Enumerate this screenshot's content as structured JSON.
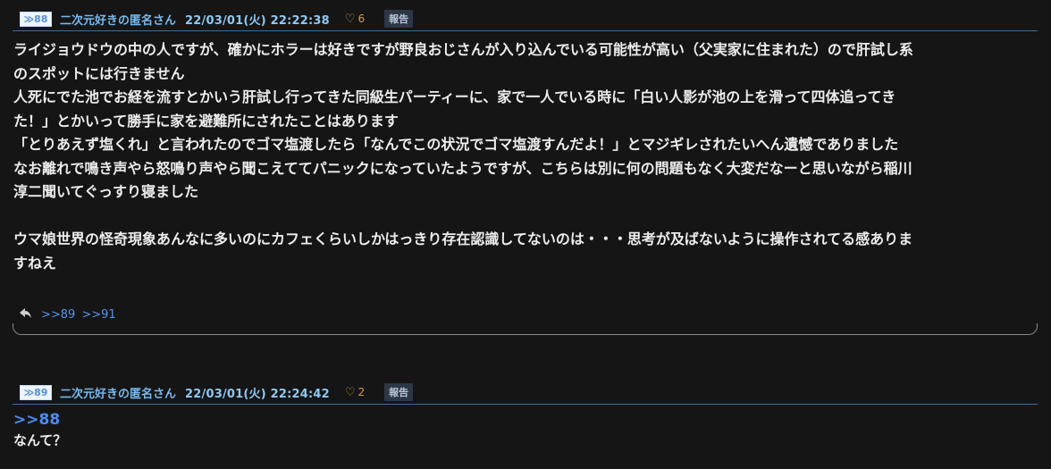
{
  "posts": [
    {
      "number": "≫88",
      "name": "二次元好きの匿名さん",
      "date": "22/03/01(火) 22:22:38",
      "likes": "6",
      "report_label": "報告",
      "body": "ライジョウドウの中の人ですが、確かにホラーは好きですが野良おじさんが入り込んでいる可能性が高い（父実家に住まれた）ので肝試し系\nのスポットには行きません\n人死にでた池でお経を流すとかいう肝試し行ってきた同級生パーティーに、家で一人でいる時に「白い人影が池の上を滑って四体追ってき\nた！」とかいって勝手に家を避難所にされたことはあります\n「とりあえず塩くれ」と言われたのでゴマ塩渡したら「なんでこの状況でゴマ塩渡すんだよ！」とマジギレされたいへん遺憾でありました\nなお離れで鳴き声やら怒鳴り声やら聞こえててパニックになっていたようですが、こちらは別に何の問題もなく大変だなーと思いながら稲川\n淳二聞いてぐっすり寝ました\n\nウマ娘世界の怪奇現象あんなに多いのにカフェくらいしかはっきり存在認識してないのは・・・思考が及ばないように操作されてる感ありま\nすねえ",
      "replies": [
        ">>89",
        ">>91"
      ]
    },
    {
      "number": "≫89",
      "name": "二次元好きの匿名さん",
      "date": "22/03/01(火) 22:24:42",
      "likes": "2",
      "report_label": "報告",
      "anchor": ">>88",
      "body": "なんて？"
    }
  ],
  "colors": {
    "accent": "#7cc2f2",
    "likes": "#d79a4d",
    "link": "#4d8cf2"
  },
  "icons": {
    "like": "heart-icon",
    "reply": "reply-icon"
  }
}
